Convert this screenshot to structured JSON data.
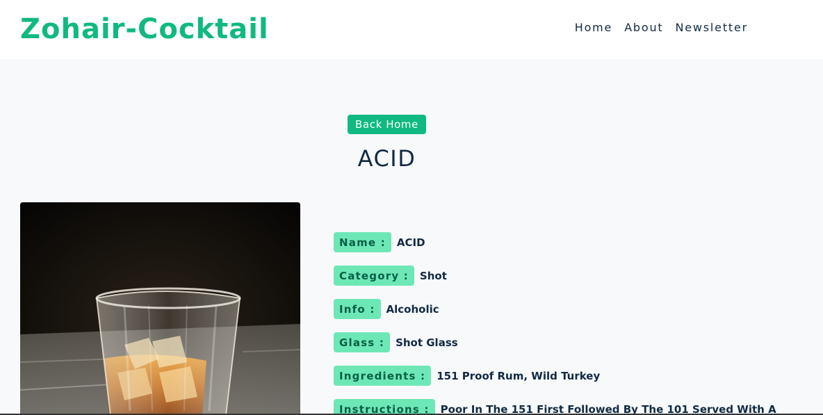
{
  "navbar": {
    "brand": "Zohair-Cocktail",
    "links": [
      "Home",
      "About",
      "Newsletter"
    ]
  },
  "page": {
    "back_button": "Back Home",
    "title": "ACID"
  },
  "details": [
    {
      "label": "Name :",
      "value": "ACID"
    },
    {
      "label": "Category :",
      "value": "Shot"
    },
    {
      "label": "Info :",
      "value": "Alcoholic"
    },
    {
      "label": "Glass :",
      "value": "Shot Glass"
    },
    {
      "label": "Ingredients :",
      "value": "151 Proof Rum,  Wild Turkey"
    },
    {
      "label": "Instructions :",
      "value": "Poor In The 151 First Followed By The 101 Served With A"
    }
  ],
  "colors": {
    "accent": "#10b981",
    "label_bg": "#6ee7b7",
    "label_text": "#065f46",
    "text": "#102a43",
    "background": "#f8f9fb"
  }
}
